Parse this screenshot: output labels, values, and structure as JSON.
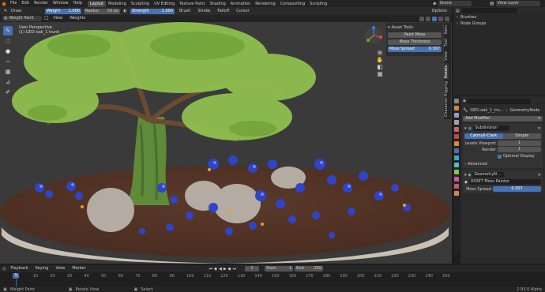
{
  "topbar": {
    "menus": [
      "File",
      "Edit",
      "Render",
      "Window",
      "Help"
    ],
    "workspaces": [
      "Layout",
      "Modeling",
      "Sculpting",
      "UV Editing",
      "Texture Paint",
      "Shading",
      "Animation",
      "Rendering",
      "Compositing",
      "Scripting"
    ],
    "active_workspace": "Layout",
    "scene_label": "Scene",
    "view_layer_label": "View Layer"
  },
  "toolheader": {
    "tool_name": "Draw",
    "weight_label": "Weight",
    "weight_value": "1.000",
    "radius_label": "Radius",
    "radius_value": "50 px",
    "strength_label": "Strength",
    "strength_value": "1.000",
    "menus": [
      "Brush",
      "Stroke",
      "Falloff",
      "Cursor"
    ],
    "options_label": "Options"
  },
  "viewport": {
    "mode": "Weight Paint",
    "menus": [
      "View",
      "Weights"
    ],
    "perspective_label": "User Perspective",
    "object_label": "(1) GEO-oak_1 trunk"
  },
  "asset_tools": {
    "title": "Asset Tools",
    "paint_moss": "Paint Moss",
    "moss_thickness": "Moss Thickness",
    "moss_spread_label": "Moss Spread",
    "moss_spread_value": "0.307"
  },
  "sidebar_tabs": [
    "Item",
    "Tool",
    "View",
    "Assets"
  ],
  "outliner": {
    "brushes": "Brushes",
    "node_groups": "Node Groups"
  },
  "side_tab": "Character Rigging",
  "properties": {
    "object_name": "GEO-oak_1_tru...",
    "node_group": "GeometryNode",
    "add_modifier": "Add Modifier",
    "subdivision_name": "Subdivision",
    "catmull_clark": "Catmull-Clark",
    "simple": "Simple",
    "levels_viewport_label": "Levels Viewport",
    "levels_viewport_value": "1",
    "render_label": "Render",
    "render_value": "1",
    "optimal_display": "Optimal Display",
    "advanced": "Advanced",
    "geometry_nodes_name": "GeometryN...",
    "geo_node_tree": "ASSET Moss Painter",
    "moss_spread_label": "Moss Spread",
    "moss_spread_value": "0.307"
  },
  "timeline": {
    "menus": [
      "Playback",
      "Keying",
      "View",
      "Marker"
    ],
    "current_frame": "1",
    "start_label": "Start",
    "start_value": "1",
    "end_label": "End",
    "end_value": "250",
    "ticks": [
      "0",
      "10",
      "20",
      "30",
      "40",
      "50",
      "60",
      "70",
      "80",
      "90",
      "100",
      "110",
      "120",
      "130",
      "140",
      "150",
      "160",
      "170",
      "180",
      "190",
      "200",
      "210",
      "220",
      "230",
      "240",
      "250"
    ]
  },
  "statusbar": {
    "item1": "Weight Paint",
    "item2": "Rotate View",
    "item3": "Select",
    "version": "2.93.0 Alpha"
  },
  "colors": {
    "accent_blue": "#4772b3",
    "header": "#2b2b2b",
    "viewport_bg": "#3a3a3a"
  }
}
